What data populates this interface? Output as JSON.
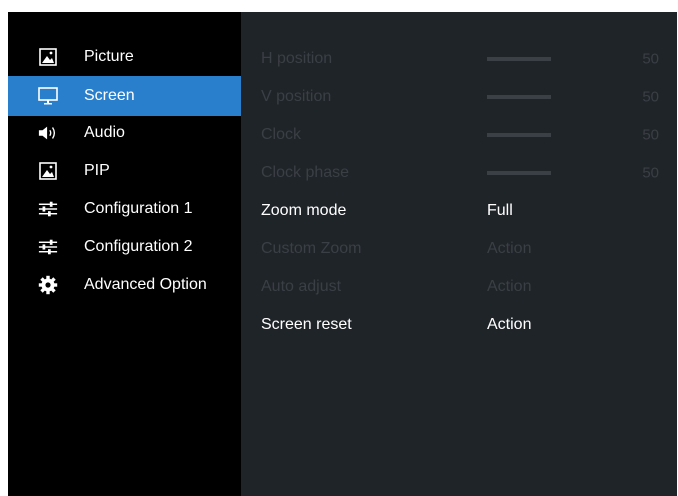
{
  "sidebar": {
    "items": [
      {
        "label": "Picture",
        "icon": "picture-icon"
      },
      {
        "label": "Screen",
        "icon": "monitor-icon",
        "selected": true
      },
      {
        "label": "Audio",
        "icon": "speaker-icon"
      },
      {
        "label": "PIP",
        "icon": "pip-icon"
      },
      {
        "label": "Configuration 1",
        "icon": "sliders-icon"
      },
      {
        "label": "Configuration 2",
        "icon": "sliders-icon"
      },
      {
        "label": "Advanced Option",
        "icon": "gear-icon"
      }
    ]
  },
  "screen_menu": {
    "h_position": {
      "label": "H position",
      "value": "50"
    },
    "v_position": {
      "label": "V position",
      "value": "50"
    },
    "clock": {
      "label": "Clock",
      "value": "50"
    },
    "clock_phase": {
      "label": "Clock phase",
      "value": "50"
    },
    "zoom_mode": {
      "label": "Zoom mode",
      "value": "Full"
    },
    "custom_zoom": {
      "label": "Custom Zoom",
      "value": "Action"
    },
    "auto_adjust": {
      "label": "Auto adjust",
      "value": "Action"
    },
    "screen_reset": {
      "label": "Screen reset",
      "value": "Action"
    }
  },
  "colors": {
    "accent": "#2a7fcd",
    "panel": "#1f2429",
    "sidebar": "#000000",
    "disabled_text": "#3a3f45",
    "active_text": "#ffffff"
  }
}
